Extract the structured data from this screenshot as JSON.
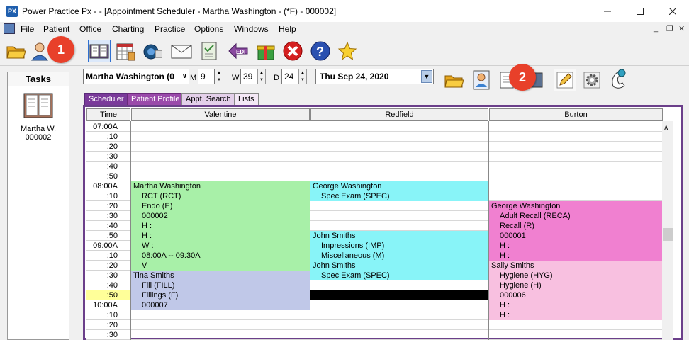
{
  "window": {
    "title": "Power Practice Px -  - [Appointment Scheduler - Martha Washington - (*F) - 000002]",
    "logo": "PX"
  },
  "menu": [
    "File",
    "Patient",
    "Office",
    "Charting",
    "Practice",
    "Options",
    "Windows",
    "Help"
  ],
  "callouts": [
    "1",
    "2"
  ],
  "tasks": {
    "header": "Tasks",
    "item_name": "Martha W.",
    "item_id": "000002"
  },
  "selector": {
    "patient": "Martha Washington (0",
    "m_label": "M",
    "m_value": "9",
    "w_label": "W",
    "w_value": "39",
    "d_label": "D",
    "d_value": "24",
    "date": "Thu  Sep 24, 2020"
  },
  "tabs": [
    "Scheduler",
    "Patient Profile",
    "Appt. Search",
    "Lists"
  ],
  "columns": {
    "time": "Time",
    "providers": [
      "Valentine",
      "Redfield",
      "Burton"
    ]
  },
  "times": [
    "07:00A",
    ":10",
    ":20",
    ":30",
    ":40",
    ":50",
    "08:00A",
    ":10",
    ":20",
    ":30",
    ":40",
    ":50",
    "09:00A",
    ":10",
    ":20",
    ":30",
    ":40",
    ":50",
    "10:00A",
    ":10",
    ":20",
    ":30"
  ],
  "highlight_time_index": 17,
  "appointments": {
    "valentine": [
      {
        "row": 6,
        "text": "Martha Washington",
        "indent": false,
        "color": "#a8f0a8"
      },
      {
        "row": 7,
        "text": "RCT (RCT)",
        "indent": true,
        "color": "#a8f0a8"
      },
      {
        "row": 8,
        "text": "Endo (E)",
        "indent": true,
        "color": "#a8f0a8"
      },
      {
        "row": 9,
        "text": "000002",
        "indent": true,
        "color": "#a8f0a8"
      },
      {
        "row": 10,
        "text": "H :",
        "indent": true,
        "color": "#a8f0a8"
      },
      {
        "row": 11,
        "text": "H :",
        "indent": true,
        "color": "#a8f0a8"
      },
      {
        "row": 12,
        "text": "W :",
        "indent": true,
        "color": "#a8f0a8"
      },
      {
        "row": 13,
        "text": "08:00A -- 09:30A",
        "indent": true,
        "color": "#a8f0a8"
      },
      {
        "row": 14,
        "text": "V",
        "indent": true,
        "color": "#a8f0a8"
      },
      {
        "row": 15,
        "text": "Tina Smiths",
        "indent": false,
        "color": "#c0c8e8"
      },
      {
        "row": 16,
        "text": "Fill (FILL)",
        "indent": true,
        "color": "#c0c8e8"
      },
      {
        "row": 17,
        "text": "Fillings (F)",
        "indent": true,
        "color": "#c0c8e8"
      },
      {
        "row": 18,
        "text": "000007",
        "indent": true,
        "color": "#c0c8e8"
      }
    ],
    "redfield": [
      {
        "row": 6,
        "text": "George Washington",
        "indent": false,
        "color": "#88f4f8"
      },
      {
        "row": 7,
        "text": "Spec Exam (SPEC)",
        "indent": true,
        "color": "#88f4f8"
      },
      {
        "row": 11,
        "text": "John Smiths",
        "indent": false,
        "color": "#88f4f8"
      },
      {
        "row": 12,
        "text": "Impressions (IMP)",
        "indent": true,
        "color": "#88f4f8"
      },
      {
        "row": 13,
        "text": "Miscellaneous (M)",
        "indent": true,
        "color": "#88f4f8"
      },
      {
        "row": 14,
        "text": "John Smiths",
        "indent": false,
        "color": "#88f4f8"
      },
      {
        "row": 15,
        "text": "Spec Exam (SPEC)",
        "indent": true,
        "color": "#88f4f8"
      },
      {
        "row": 17,
        "text": "",
        "indent": false,
        "color": "#000000"
      }
    ],
    "burton": [
      {
        "row": 8,
        "text": "George Washington",
        "indent": false,
        "color": "#f080d0"
      },
      {
        "row": 9,
        "text": "Adult Recall (RECA)",
        "indent": true,
        "color": "#f080d0"
      },
      {
        "row": 10,
        "text": "Recall (R)",
        "indent": true,
        "color": "#f080d0"
      },
      {
        "row": 11,
        "text": "000001",
        "indent": true,
        "color": "#f080d0"
      },
      {
        "row": 12,
        "text": "H :",
        "indent": true,
        "color": "#f080d0"
      },
      {
        "row": 13,
        "text": "H :",
        "indent": true,
        "color": "#f080d0"
      },
      {
        "row": 14,
        "text": "Sally Smiths",
        "indent": false,
        "color": "#f8c0e0"
      },
      {
        "row": 15,
        "text": "Hygiene (HYG)",
        "indent": true,
        "color": "#f8c0e0"
      },
      {
        "row": 16,
        "text": "Hygiene (H)",
        "indent": true,
        "color": "#f8c0e0"
      },
      {
        "row": 17,
        "text": "000006",
        "indent": true,
        "color": "#f8c0e0"
      },
      {
        "row": 18,
        "text": "H :",
        "indent": true,
        "color": "#f8c0e0"
      },
      {
        "row": 19,
        "text": "H :",
        "indent": true,
        "color": "#f8c0e0"
      }
    ]
  },
  "icons": {
    "toolbar": [
      "folder-icon",
      "patient-icon",
      "scheduler-book-icon",
      "calendar-icon",
      "camera-icon",
      "mail-icon",
      "chart-notes-icon",
      "edi-icon",
      "gift-icon",
      "close-icon",
      "help-icon",
      "star-icon"
    ],
    "secondary": [
      "folder-icon",
      "patient-card-icon",
      "document-icon",
      "book-icon",
      "pencil-icon",
      "gear-icon",
      "phone-icon"
    ]
  },
  "colors": {
    "accent_purple": "#6b3f8a",
    "callout_red": "#e8402a",
    "green": "#a8f0a8",
    "cyan": "#88f4f8",
    "pink": "#f080d0",
    "light_pink": "#f8c0e0",
    "lavender": "#c0c8e8",
    "highlight_yellow": "#ffff99"
  }
}
